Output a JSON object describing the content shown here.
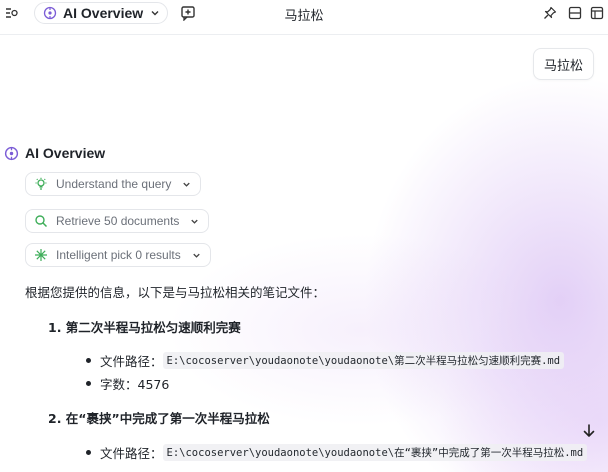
{
  "header": {
    "model_label": "AI Overview",
    "title": "马拉松"
  },
  "conversation": {
    "user_message": "马拉松",
    "overview_title": "AI Overview",
    "steps": [
      {
        "label": "Understand the query"
      },
      {
        "label": "Retrieve 50 documents"
      },
      {
        "label": "Intelligent pick 0 results"
      }
    ],
    "answer_intro": "根据您提供的信息，以下是与马拉松相关的笔记文件：",
    "results": [
      {
        "title": "1. 第二次半程马拉松匀速顺利完赛",
        "path_label": "文件路径：",
        "path": "E:\\cocoserver\\youdaonote\\youdaonote\\第二次半程马拉松匀速顺利完赛.md",
        "count_label": "字数：4576"
      },
      {
        "title": "2. 在“裹挟”中完成了第一次半程马拉松",
        "path_label": "文件路径：",
        "path": "E:\\cocoserver\\youdaonote\\youdaonote\\在“裹挟”中完成了第一次半程马拉松.md"
      }
    ]
  },
  "colors": {
    "accent": "#7b5cd6",
    "step_icon_green": "#3fae5a"
  }
}
